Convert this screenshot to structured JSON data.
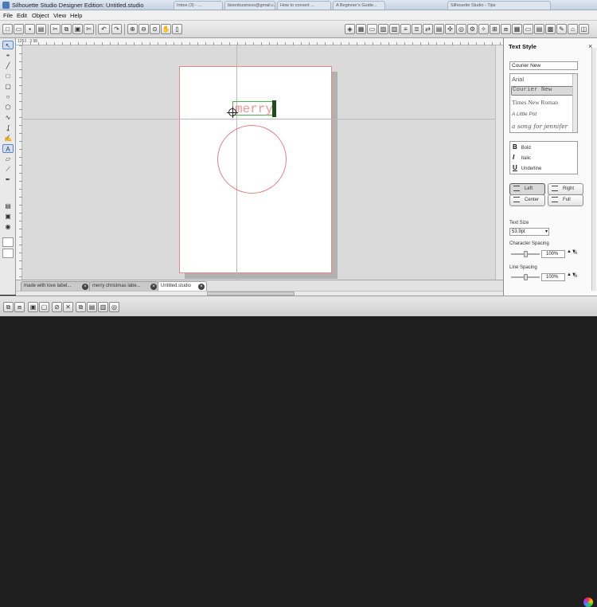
{
  "window": {
    "title": "Silhouette Studio Designer Edition: Untitled.studio",
    "background_tabs": [
      "Inbox (3) - ...",
      "bizenbusiness@gmail.c...",
      "How to convert ...",
      "A Beginner's Guide...",
      "Silhouette Studio - Tips"
    ]
  },
  "menu": [
    "File",
    "Edit",
    "Object",
    "View",
    "Help"
  ],
  "ruler": {
    "readout": "1253 . 3 98"
  },
  "canvas": {
    "text_object": "merry"
  },
  "doc_tabs": [
    {
      "label": "made with love label...",
      "active": false
    },
    {
      "label": "merry christmas labe...",
      "active": false
    },
    {
      "label": "Untitled.studio",
      "active": true
    }
  ],
  "panel": {
    "title": "Text Style",
    "font_input": "Courier New",
    "fonts": [
      "Arial",
      "Courier New",
      "Times New Roman",
      "A Little Pot",
      "a song for jennifer"
    ],
    "selected_font": "Courier New",
    "styles": [
      "Bold",
      "Italic",
      "Underline"
    ],
    "style_glyphs": [
      "B",
      "I",
      "U"
    ],
    "align": {
      "left": "Left",
      "right": "Right",
      "center": "Center",
      "full": "Full",
      "selected": "Left"
    },
    "text_size_label": "Text Size",
    "text_size_value": "53.9pt",
    "char_spacing_label": "Character Spacing",
    "char_spacing_value": "100%",
    "line_spacing_label": "Line Spacing",
    "line_spacing_value": "100%",
    "percent_unit": "%"
  },
  "icons": {
    "close": "×",
    "dropdown": "▾",
    "spin": "▲▼"
  }
}
